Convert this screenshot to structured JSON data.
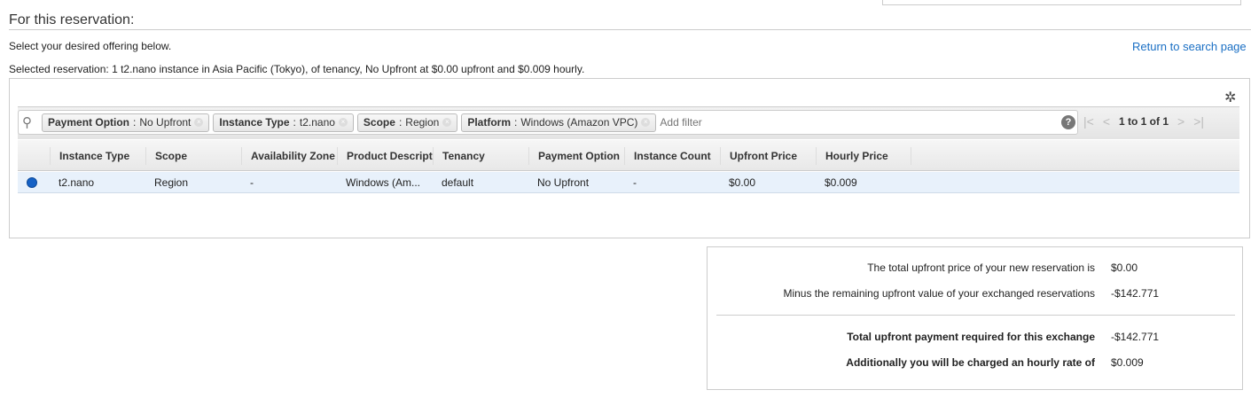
{
  "title": "For this reservation:",
  "instruction": "Select your desired offering below.",
  "return_link": "Return to search page",
  "selected_text": "Selected reservation: 1 t2.nano instance in Asia Pacific (Tokyo), of tenancy, No Upfront at $0.00 upfront and $0.009 hourly.",
  "filters": [
    {
      "key": "Payment Option",
      "value": "No Upfront"
    },
    {
      "key": "Instance Type",
      "value": "t2.nano"
    },
    {
      "key": "Scope",
      "value": "Region"
    },
    {
      "key": "Platform",
      "value": "Windows (Amazon VPC)"
    }
  ],
  "filter_sep": ":",
  "add_filter_placeholder": "Add filter",
  "pager": "1 to 1 of 1",
  "columns": [
    "Instance Type",
    "Scope",
    "Availability Zone",
    "Product Description",
    "Tenancy",
    "Payment Option",
    "Instance Count",
    "Upfront Price",
    "Hourly Price"
  ],
  "row": {
    "selected": true,
    "cells": [
      "t2.nano",
      "Region",
      "-",
      "Windows (Am...",
      "default",
      "No Upfront",
      "-",
      "$0.00",
      "$0.009"
    ]
  },
  "summary": [
    {
      "label": "The total upfront price of your new reservation is",
      "value": "$0.00"
    },
    {
      "label": "Minus the remaining upfront value of your exchanged reservations",
      "value": "-$142.771"
    },
    {
      "label": "Total upfront payment required for this exchange",
      "value": "-$142.771"
    },
    {
      "label": "Additionally you will be charged an hourly rate of",
      "value": "$0.009"
    }
  ],
  "colors": {
    "link": "#1a6fc4",
    "selected_row": "#e8f1fb",
    "radio": "#1561c5"
  }
}
